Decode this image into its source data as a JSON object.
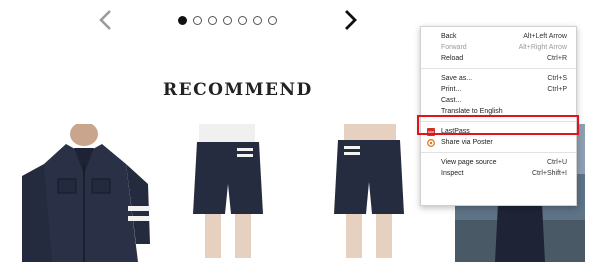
{
  "carousel": {
    "prev_icon": "chevron-left-icon",
    "next_icon": "chevron-right-icon",
    "dot_count": 7,
    "active_dot": 1
  },
  "section": {
    "title": "RECOMMEND"
  },
  "products": [
    {
      "name": "denim-jacket"
    },
    {
      "name": "denim-shorts-back"
    },
    {
      "name": "denim-shorts-side"
    },
    {
      "name": "denim-outfit"
    }
  ],
  "context_menu": {
    "back": {
      "label": "Back",
      "shortcut": "Alt+Left Arrow"
    },
    "forward": {
      "label": "Forward",
      "shortcut": "Alt+Right Arrow"
    },
    "reload": {
      "label": "Reload",
      "shortcut": "Ctrl+R"
    },
    "save_as": {
      "label": "Save as...",
      "shortcut": "Ctrl+S"
    },
    "print": {
      "label": "Print...",
      "shortcut": "Ctrl+P"
    },
    "cast": {
      "label": "Cast..."
    },
    "translate": {
      "label": "Translate to English"
    },
    "lastpass": {
      "label": "LastPass",
      "icon": "lastpass-icon"
    },
    "share_poster": {
      "label": "Share via Poster",
      "icon": "poster-icon"
    },
    "view_source": {
      "label": "View page source",
      "shortcut": "Ctrl+U"
    },
    "inspect": {
      "label": "Inspect",
      "shortcut": "Ctrl+Shift+I"
    }
  },
  "colors": {
    "highlight": "#e0141b",
    "denim": "#262c3f",
    "lastpass": "#d32d27"
  }
}
